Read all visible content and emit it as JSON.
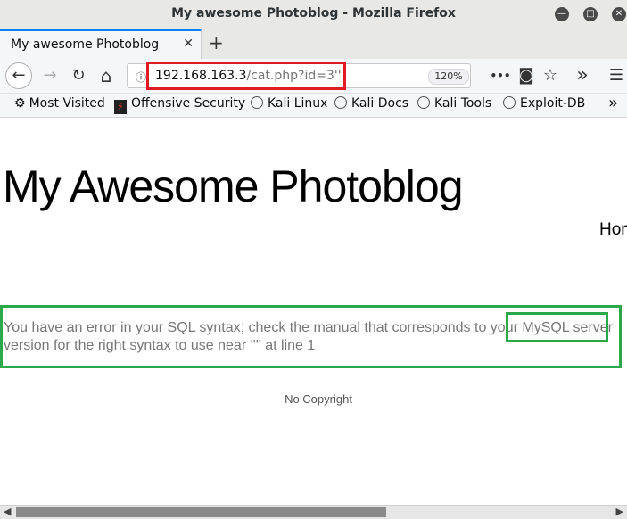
{
  "window": {
    "title": "My awesome Photoblog - Mozilla Firefox"
  },
  "tab": {
    "label": "My awesome Photoblog",
    "close": "✕",
    "new_tab": "+"
  },
  "toolbar": {
    "back": "←",
    "forward": "→",
    "reload": "↻",
    "home": "⌂",
    "info": "ⓘ",
    "url_host": "192.168.163.3",
    "url_path": "/cat.php?id=3''",
    "zoom": "120%",
    "more": "•••",
    "pocket": "◙",
    "bookmark": "☆",
    "overflow": "»",
    "menu": "☰"
  },
  "bookmarks": [
    {
      "label": "Most Visited",
      "icon": "gear-icon"
    },
    {
      "label": "Offensive Security",
      "icon": "offsec-icon"
    },
    {
      "label": "Kali Linux",
      "icon": "globe-icon"
    },
    {
      "label": "Kali Docs",
      "icon": "globe-icon"
    },
    {
      "label": "Kali Tools",
      "icon": "globe-icon"
    },
    {
      "label": "Exploit-DB",
      "icon": "globe-icon"
    }
  ],
  "bookmarks_overflow": "»",
  "page": {
    "title": "My Awesome Photoblog",
    "nav_link": "Hom",
    "error_before": "You have an error in your SQL syntax; check the manual that corresponds to your ",
    "error_highlight": "MySQL server",
    "error_after": " version for the right syntax to use near '''' at line 1",
    "footer": "No Copyright"
  },
  "annotations": {
    "url_box_color": "#e01b24",
    "error_box_color": "#2aa84a"
  }
}
